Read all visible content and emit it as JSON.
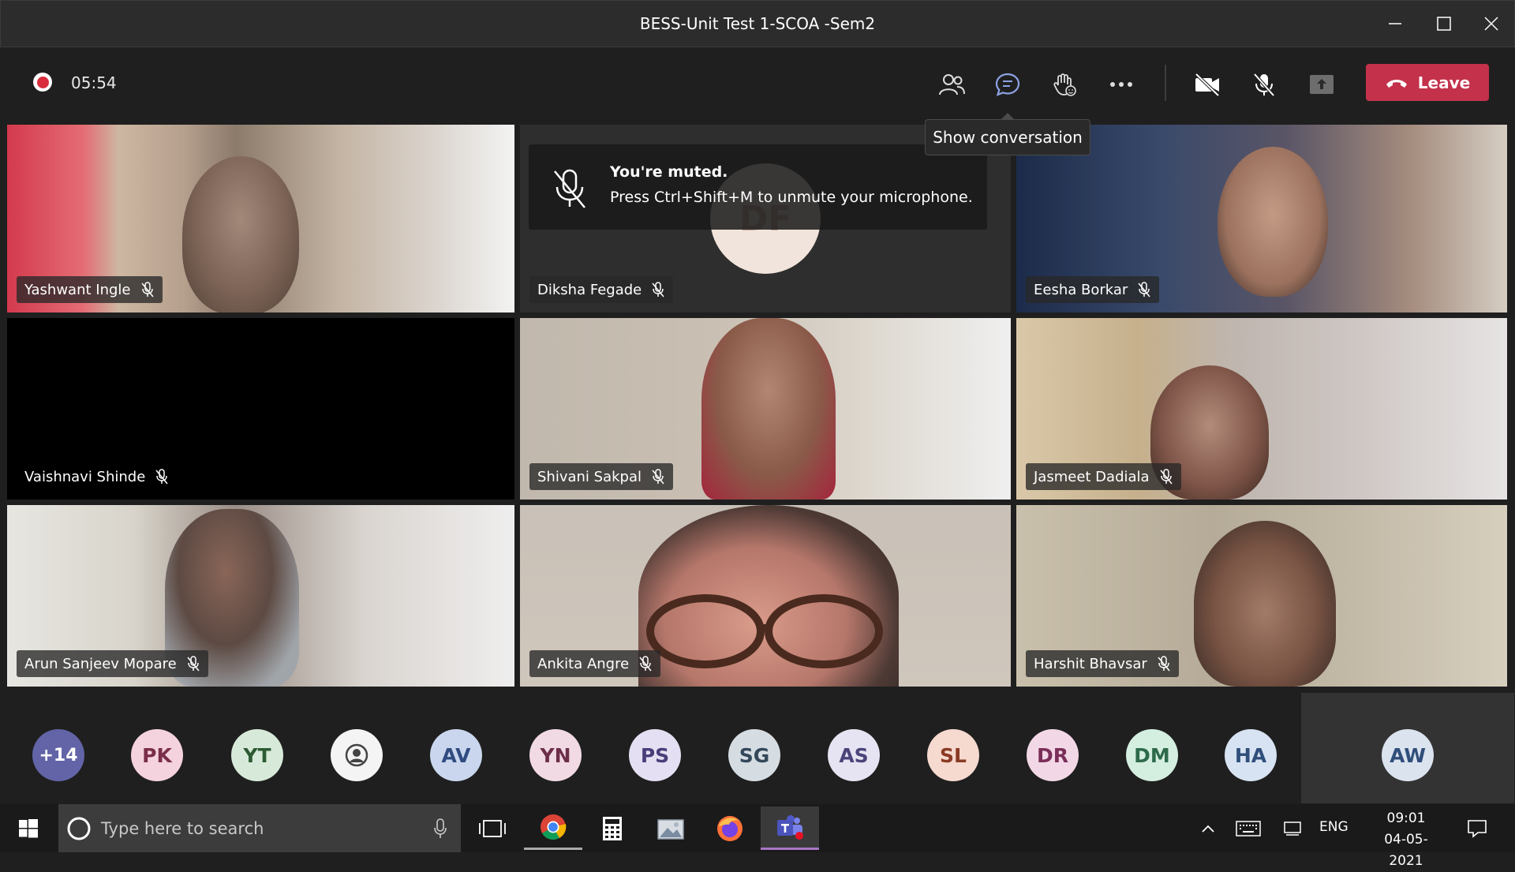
{
  "window": {
    "title": "BESS-Unit Test 1-SCOA -Sem2"
  },
  "toolbar": {
    "timer": "05:54",
    "leave_label": "Leave",
    "tooltip": "Show conversation"
  },
  "muted_banner": {
    "title": "You're muted.",
    "description": "Press Ctrl+Shift+M to unmute your microphone."
  },
  "tiles": [
    {
      "name": "Yashwant Ingle"
    },
    {
      "name": "Diksha Fegade",
      "initials": "DF"
    },
    {
      "name": "Eesha Borkar"
    },
    {
      "name": "Vaishnavi Shinde"
    },
    {
      "name": "Shivani Sakpal"
    },
    {
      "name": "Jasmeet Dadiala"
    },
    {
      "name": "Arun Sanjeev Mopare"
    },
    {
      "name": "Ankita Angre"
    },
    {
      "name": "Harshit Bhavsar"
    }
  ],
  "participants": {
    "overflow": "+14",
    "avatars": [
      {
        "initials": "PK",
        "bg": "#f4d2de",
        "fg": "#7a2e4a"
      },
      {
        "initials": "YT",
        "bg": "#d7ead9",
        "fg": "#2d5a33"
      },
      {
        "initials": "",
        "bg": "#f4f4f4",
        "fg": "#444444"
      },
      {
        "initials": "AV",
        "bg": "#c9d6ee",
        "fg": "#2f4b80"
      },
      {
        "initials": "YN",
        "bg": "#f1dae4",
        "fg": "#6d2e4a"
      },
      {
        "initials": "PS",
        "bg": "#e4dff2",
        "fg": "#4a3d7a"
      },
      {
        "initials": "SG",
        "bg": "#d6dde2",
        "fg": "#33485a"
      },
      {
        "initials": "AS",
        "bg": "#e6e4f2",
        "fg": "#4a447a"
      },
      {
        "initials": "SL",
        "bg": "#f6d9cf",
        "fg": "#8a3b23"
      },
      {
        "initials": "DR",
        "bg": "#f2d8e6",
        "fg": "#7a2e58"
      },
      {
        "initials": "DM",
        "bg": "#d4eedf",
        "fg": "#2d6a4a"
      },
      {
        "initials": "HA",
        "bg": "#d7e3f2",
        "fg": "#2f4e7a"
      },
      {
        "initials": "AW",
        "bg": "#dbe3ef",
        "fg": "#2f4e7a"
      }
    ]
  },
  "taskbar": {
    "search_placeholder": "Type here to search",
    "language": "ENG",
    "time": "09:01",
    "date": "04-05-2021"
  },
  "colors": {
    "leave": "#c4314b",
    "recording": "#d92c3c",
    "teams_accent": "#6264a7"
  }
}
